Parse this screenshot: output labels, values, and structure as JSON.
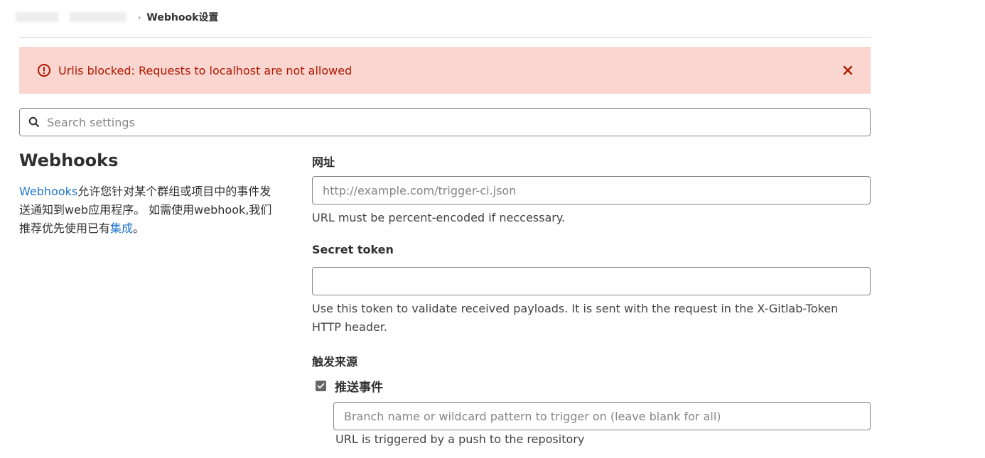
{
  "breadcrumb": {
    "current": "Webhook设置"
  },
  "alert": {
    "message": "Urlis blocked: Requests to localhost are not allowed",
    "color": "#ae1800",
    "background": "#fbd5d0",
    "icon": "error-circle-icon",
    "close_icon": "close-icon"
  },
  "search": {
    "placeholder": "Search settings",
    "value": ""
  },
  "section": {
    "title": "Webhooks",
    "desc_link1": "Webhooks",
    "desc_text1": "允许您针对某个群组或项目中的事件发送通知到web应用程序。 如需使用webhook,我们推荐优先使用已有",
    "desc_link2": "集成",
    "desc_text2": "。"
  },
  "form": {
    "url_label": "网址",
    "url_placeholder": "http://example.com/trigger-ci.json",
    "url_value": "",
    "url_help": "URL must be percent-encoded if neccessary.",
    "token_label": "Secret token",
    "token_value": "",
    "token_help": "Use this token to validate received payloads. It is sent with the request in the X-Gitlab-Token HTTP header.",
    "trigger_label": "触发来源",
    "push_events_label": "推送事件",
    "push_events_checked": true,
    "branch_placeholder": "Branch name or wildcard pattern to trigger on (leave blank for all)",
    "branch_value": "",
    "branch_help": "URL is triggered by a push to the repository"
  },
  "colors": {
    "link": "#1f75cb",
    "text": "#303030",
    "border": "#868686"
  }
}
